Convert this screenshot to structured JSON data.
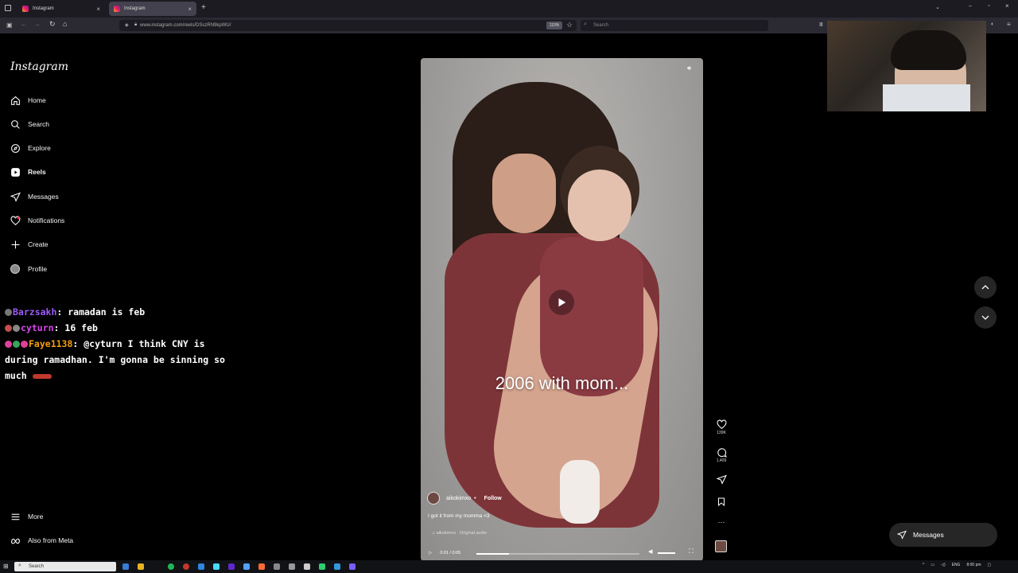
{
  "browser": {
    "tabs": [
      {
        "title": "Instagram",
        "active": false
      },
      {
        "title": "Instagram",
        "active": true
      }
    ],
    "url": "www.instagram.com/reels/DSszRN9kpWU/",
    "zoom": "110%",
    "search_placeholder": "Search"
  },
  "sidebar": {
    "logo": "Instagram",
    "items": [
      {
        "label": "Home",
        "icon": "home-icon"
      },
      {
        "label": "Search",
        "icon": "search-icon"
      },
      {
        "label": "Explore",
        "icon": "compass-icon"
      },
      {
        "label": "Reels",
        "icon": "reels-icon",
        "active": true
      },
      {
        "label": "Messages",
        "icon": "messenger-icon"
      },
      {
        "label": "Notifications",
        "icon": "heart-icon"
      },
      {
        "label": "Create",
        "icon": "plus-icon"
      },
      {
        "label": "Profile",
        "icon": "avatar-icon"
      }
    ],
    "bottom": [
      {
        "label": "More",
        "icon": "menu-icon"
      },
      {
        "label": "Also from Meta",
        "icon": "meta-icon"
      }
    ]
  },
  "chat": {
    "messages": [
      {
        "user": "Barzsakh",
        "text": ": ramadan is feb"
      },
      {
        "user": "cyturn",
        "text": ": 16 feb"
      },
      {
        "user": "Faye1138",
        "text": ": @cyturn I think CNY is during ramadhan. I'm gonna be sinning so much"
      }
    ]
  },
  "reel": {
    "overlay_caption": "2006 with mom...",
    "author": "aikokimxo",
    "follow_label": "Follow",
    "description": "I got it from my momma <3",
    "audio": "aikokimxo · Original audio",
    "time": "0:01 / 0:05",
    "progress": 0.2
  },
  "actions": {
    "likes": "139K",
    "comments": "1,409"
  },
  "messages_button": "Messages",
  "taskbar": {
    "search_placeholder": "Search",
    "lang": "ENG",
    "clock": "8:00 pm"
  }
}
